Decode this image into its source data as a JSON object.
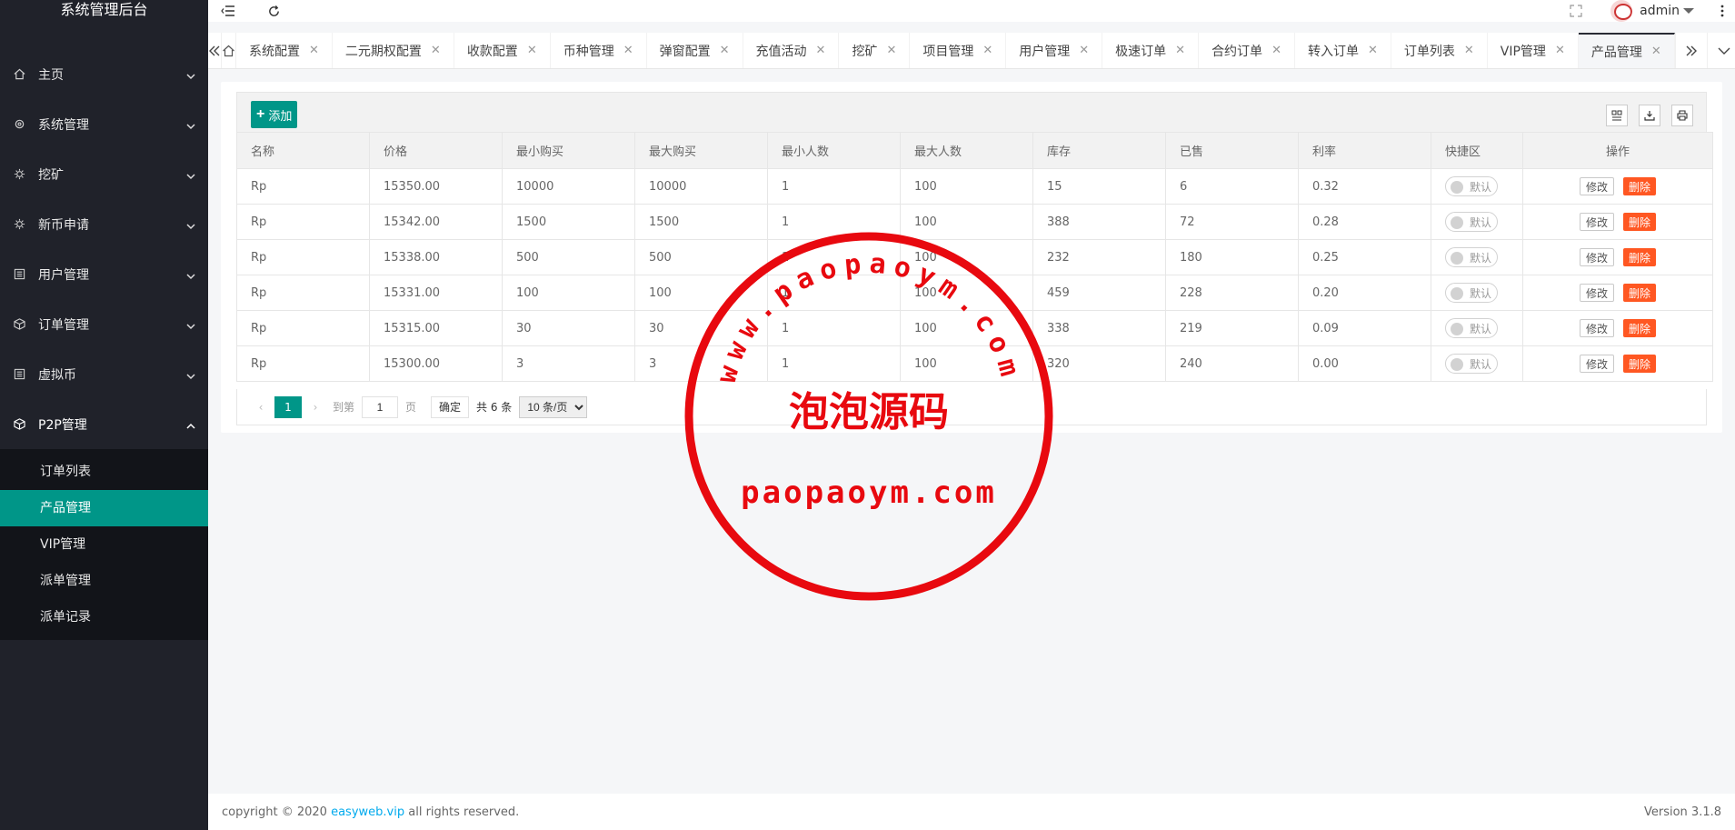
{
  "sidebar": {
    "title": "系统管理后台",
    "menu": [
      {
        "label": "主页",
        "icon": "home-icon"
      },
      {
        "label": "系统管理",
        "icon": "settings-icon"
      },
      {
        "label": "挖矿",
        "icon": "cog-icon"
      },
      {
        "label": "新币申请",
        "icon": "cog-icon"
      },
      {
        "label": "用户管理",
        "icon": "list-icon"
      },
      {
        "label": "订单管理",
        "icon": "cube-icon"
      },
      {
        "label": "虚拟币",
        "icon": "list-icon"
      },
      {
        "label": "P2P管理",
        "icon": "cube-icon"
      }
    ],
    "submenu": [
      "订单列表",
      "产品管理",
      "VIP管理",
      "派单管理",
      "派单记录"
    ],
    "active_sub": "产品管理"
  },
  "topbar": {
    "user": "admin"
  },
  "tabs": [
    "系统配置",
    "二元期权配置",
    "收款配置",
    "币种管理",
    "弹窗配置",
    "充值活动",
    "挖矿",
    "项目管理",
    "用户管理",
    "极速订单",
    "合约订单",
    "转入订单",
    "订单列表",
    "VIP管理",
    "产品管理"
  ],
  "active_tab": "产品管理",
  "toolbar": {
    "add_label": "添加"
  },
  "table": {
    "headers": [
      "名称",
      "价格",
      "最小购买",
      "最大购买",
      "最小人数",
      "最大人数",
      "库存",
      "已售",
      "利率",
      "快捷区",
      "操作"
    ],
    "rows": [
      [
        "Rp",
        "15350.00",
        "10000",
        "10000",
        "1",
        "100",
        "15",
        "6",
        "0.32"
      ],
      [
        "Rp",
        "15342.00",
        "1500",
        "1500",
        "1",
        "100",
        "388",
        "72",
        "0.28"
      ],
      [
        "Rp",
        "15338.00",
        "500",
        "500",
        "1",
        "100",
        "232",
        "180",
        "0.25"
      ],
      [
        "Rp",
        "15331.00",
        "100",
        "100",
        "1",
        "100",
        "459",
        "228",
        "0.20"
      ],
      [
        "Rp",
        "15315.00",
        "30",
        "30",
        "1",
        "100",
        "338",
        "219",
        "0.09"
      ],
      [
        "Rp",
        "15300.00",
        "3",
        "3",
        "1",
        "100",
        "320",
        "240",
        "0.00"
      ]
    ],
    "switch_label": "默认",
    "edit_label": "修改",
    "delete_label": "删除"
  },
  "pager": {
    "current": "1",
    "goto_label": "到第",
    "goto_value": "1",
    "page_unit": "页",
    "ok_label": "确定",
    "total": "共 6 条",
    "page_size": "10 条/页"
  },
  "stamp": {
    "top_text": "www.paopaoym.com",
    "middle_text": "泡泡源码",
    "bottom_text": "paopaoym.com"
  },
  "footer": {
    "copyright_prefix": "copyright © 2020",
    "link_text": "easyweb.vip",
    "copyright_suffix": "all rights reserved.",
    "version": "Version 3.1.8"
  },
  "colors": {
    "accent": "#009688",
    "danger": "#ff5722",
    "sidebar_bg": "#20222a",
    "stamp_red": "#e8090f"
  }
}
